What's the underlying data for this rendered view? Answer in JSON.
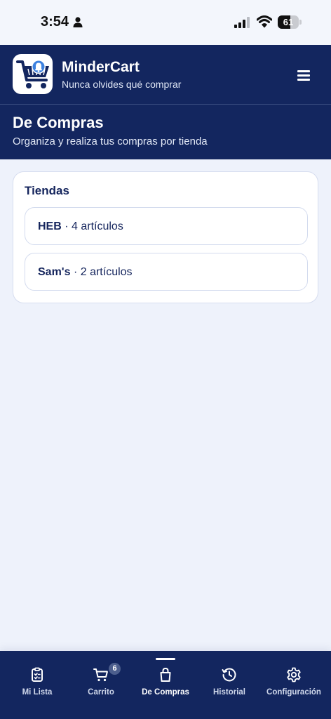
{
  "status_bar": {
    "time": "3:54",
    "battery": "61",
    "battery_level": 0.61
  },
  "header": {
    "app_name": "MinderCart",
    "tagline": "Nunca olvides qué comprar"
  },
  "page": {
    "title": "De Compras",
    "subtitle": "Organiza y realiza tus compras por tienda"
  },
  "stores": {
    "title": "Tiendas",
    "items": [
      {
        "name": "HEB",
        "count": "· 4 artículos"
      },
      {
        "name": "Sam's",
        "count": "· 2 artículos"
      }
    ]
  },
  "nav": {
    "items": [
      {
        "label": "Mi Lista",
        "icon": "clipboard-list-icon"
      },
      {
        "label": "Carrito",
        "icon": "cart-icon",
        "badge": "6"
      },
      {
        "label": "De Compras",
        "icon": "shopping-bag-icon",
        "active": true
      },
      {
        "label": "Historial",
        "icon": "history-icon"
      },
      {
        "label": "Configuración",
        "icon": "gear-icon"
      }
    ]
  },
  "colors": {
    "primary": "#13265f",
    "background": "#eef2fb",
    "card": "#ffffff"
  }
}
